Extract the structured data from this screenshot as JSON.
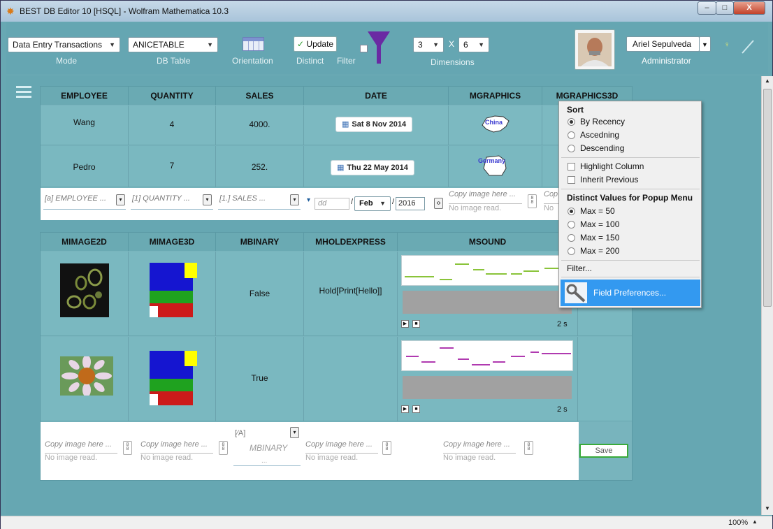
{
  "window": {
    "title": "BEST DB Editor 10 [HSQL] - Wolfram Mathematica 10.3",
    "controls": {
      "minimize": "–",
      "maximize": "□",
      "close": "X"
    }
  },
  "toolbar": {
    "mode": {
      "value": "Data Entry Transactions",
      "caption": "Mode"
    },
    "db_table": {
      "value": "ANICETABLE",
      "caption": "DB Table"
    },
    "orientation": {
      "caption": "Orientation"
    },
    "distinct": {
      "button": "Update",
      "caption": "Distinct"
    },
    "filter": {
      "caption": "Filter"
    },
    "dimensions": {
      "rows": "3",
      "x": "X",
      "cols": "6",
      "caption": "Dimensions"
    },
    "user": {
      "name": "Ariel Sepulveda",
      "role": "Administrator"
    }
  },
  "table1": {
    "headers": [
      "EMPLOYEE",
      "QUANTITY",
      "SALES",
      "DATE",
      "MGRAPHICS",
      "MGRAPHICS3D"
    ],
    "rows": [
      {
        "employee": "Wang",
        "quantity": "4",
        "sales": "4000.",
        "date": "Sat 8 Nov 2014",
        "map": "China"
      },
      {
        "employee": "Pedro",
        "quantity": "7",
        "sales": "252.",
        "date": "Thu 22 May 2014",
        "map": "Germany"
      }
    ],
    "entry": {
      "employee": "[a] EMPLOYEE ...",
      "quantity": "[1] QUANTITY ...",
      "sales": "[1.] SALES ...",
      "day_placeholder": "dd",
      "month": "Feb",
      "year": "2016",
      "copy_image": "Copy image here ...",
      "no_image": "No image read.",
      "copy_image_cut": "Cop",
      "no_image_cut": "No"
    }
  },
  "table2": {
    "headers": [
      "MIMAGE2D",
      "MIMAGE3D",
      "MBINARY",
      "MHOLDEXPRESS",
      "MSOUND"
    ],
    "rows": [
      {
        "binary": "False",
        "hold": "Hold[Print[Hello]]",
        "duration": "2 s"
      },
      {
        "binary": "True",
        "hold": "",
        "duration": "2 s"
      }
    ],
    "entry": {
      "copy_image": "Copy image here ...",
      "no_image": "No image read.",
      "binary_icon": "[⁄A]",
      "binary_label": "MBINARY",
      "binary_dots": "...",
      "save": "Save"
    }
  },
  "menu": {
    "sort_header": "Sort",
    "sort_options": [
      "By Recency",
      "Ascedning",
      "Descending"
    ],
    "checks": [
      "Highlight Column",
      "Inherit Previous"
    ],
    "distinct_header": "Distinct Values for Popup Menu",
    "max_options": [
      "Max = 50",
      "Max = 100",
      "Max = 150",
      "Max = 200"
    ],
    "filter": "Filter...",
    "field_prefs": "Field Preferences..."
  },
  "status": {
    "zoom": "100%"
  }
}
